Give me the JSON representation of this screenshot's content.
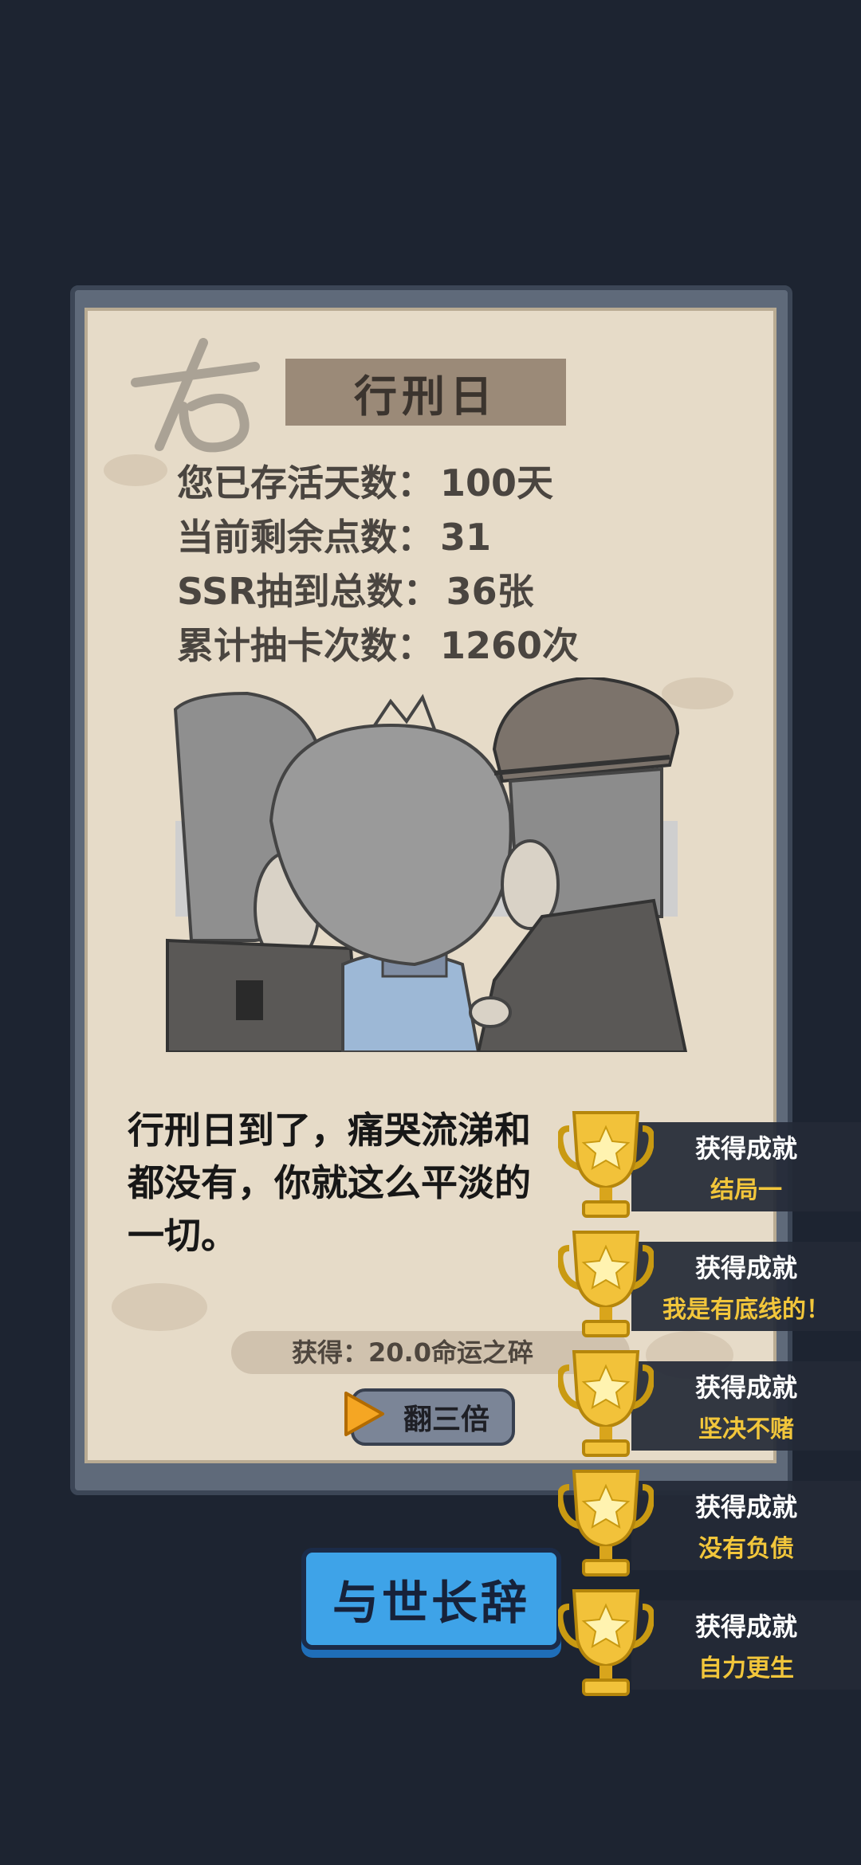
{
  "card": {
    "title": "行刑日",
    "stamp_text": "右",
    "stats": [
      {
        "label": "您已存活天数：",
        "value": "100天"
      },
      {
        "label": "当前剩余点数：",
        "value": "31"
      },
      {
        "label": "SSR抽到总数：",
        "value": "36张"
      },
      {
        "label": "累计抽卡次数：",
        "value": "1260次"
      }
    ],
    "story_lines": [
      "行刑日到了，痛哭流涕和",
      "都没有，你就这么平淡的",
      "一切。"
    ],
    "reward_text": "获得：20.0命运之碎",
    "triple_button": "翻三倍"
  },
  "farewell_button": "与世长辞",
  "achievements": [
    {
      "title": "获得成就",
      "name": "结局一"
    },
    {
      "title": "获得成就",
      "name": "我是有底线的！"
    },
    {
      "title": "获得成就",
      "name": "坚决不赌"
    },
    {
      "title": "获得成就",
      "name": "没有负债"
    },
    {
      "title": "获得成就",
      "name": "自力更生"
    }
  ],
  "colors": {
    "background": "#1d2431",
    "paper": "#e6dbc8",
    "button_blue": "#3ea3e8",
    "achievement_gold": "#f2c63b"
  }
}
